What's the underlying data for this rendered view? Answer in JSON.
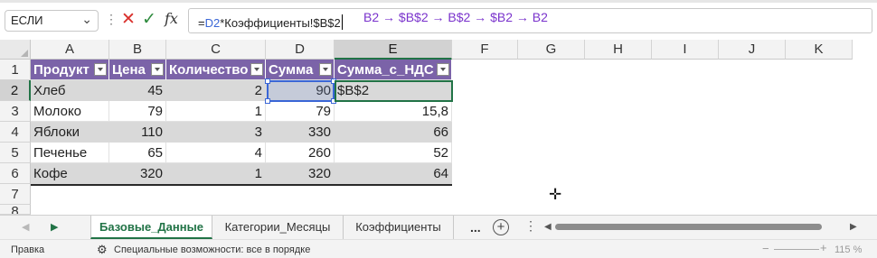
{
  "formula_bar": {
    "name_box": "ЕСЛИ",
    "formula_prefix": "=",
    "formula_ref": "D2",
    "formula_rest": "*Коэффициенты!$B$2",
    "annotation": "B2 → $B$2 → B$2 → $B2 → B2"
  },
  "columns": [
    "A",
    "B",
    "C",
    "D",
    "E",
    "F",
    "G",
    "H",
    "I",
    "J",
    "K"
  ],
  "rows": [
    "1",
    "2",
    "3",
    "4",
    "5",
    "6",
    "7",
    "8"
  ],
  "table": {
    "headers": [
      "Продукт",
      "Цена",
      "Количество",
      "Сумма",
      "Сумма_с_НДС"
    ],
    "rows": [
      [
        "Хлеб",
        "45",
        "2",
        "90",
        "$B$2"
      ],
      [
        "Молоко",
        "79",
        "1",
        "79",
        "15,8"
      ],
      [
        "Яблоки",
        "110",
        "3",
        "330",
        "66"
      ],
      [
        "Печенье",
        "65",
        "4",
        "260",
        "52"
      ],
      [
        "Кофе",
        "320",
        "1",
        "320",
        "64"
      ]
    ]
  },
  "sheet_tabs": {
    "tabs": [
      "Базовые_Данные",
      "Категории_Месяцы",
      "Коэффициенты"
    ],
    "active_index": 0,
    "more_label": "...",
    "add_label": "+"
  },
  "status_bar": {
    "mode": "Правка",
    "accessibility": "Специальные возможности: все в порядке",
    "zoom": "115 %"
  },
  "colors": {
    "table_header": "#7b63a8",
    "band": "#d9d9d9",
    "accent": "#217346",
    "ref_blue": "#3a66d6",
    "annotation": "#7a33cc"
  },
  "icons": {
    "cancel": "close-icon",
    "confirm": "check-icon",
    "function": "fx-icon",
    "cursor": "move-cursor-icon",
    "accessibility": "accessibility-icon"
  }
}
